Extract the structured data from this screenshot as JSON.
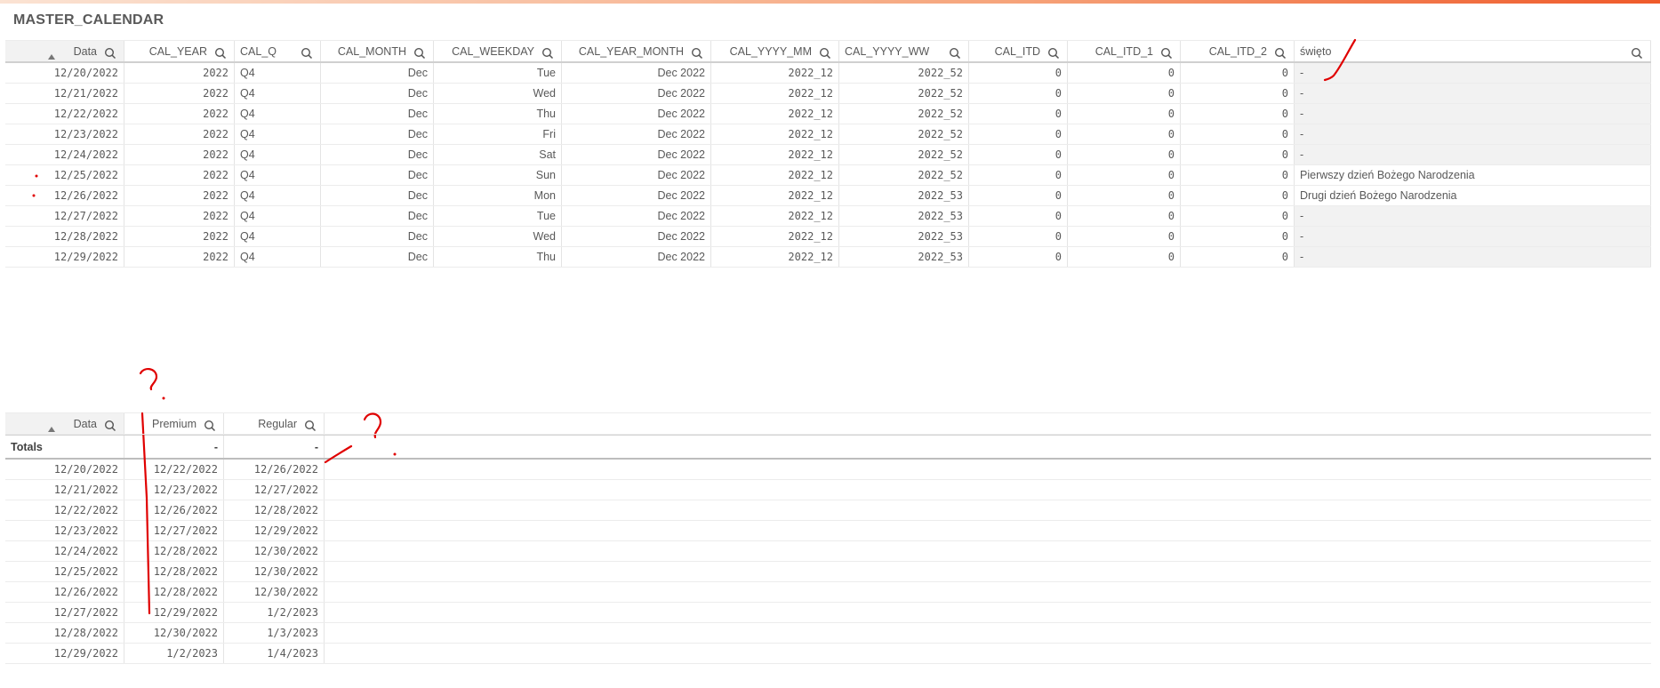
{
  "title": "MASTER_CALENDAR",
  "table1": {
    "columns": [
      "Data",
      "CAL_YEAR",
      "CAL_Q",
      "CAL_MONTH",
      "CAL_WEEKDAY",
      "CAL_YEAR_MONTH",
      "CAL_YYYY_MM",
      "CAL_YYYY_WW",
      "CAL_ITD",
      "CAL_ITD_1",
      "CAL_ITD_2",
      "święto"
    ],
    "rows": [
      [
        "12/20/2022",
        "2022",
        "Q4",
        "Dec",
        "Tue",
        "Dec 2022",
        "2022_12",
        "2022_52",
        "0",
        "0",
        "0",
        "-"
      ],
      [
        "12/21/2022",
        "2022",
        "Q4",
        "Dec",
        "Wed",
        "Dec 2022",
        "2022_12",
        "2022_52",
        "0",
        "0",
        "0",
        "-"
      ],
      [
        "12/22/2022",
        "2022",
        "Q4",
        "Dec",
        "Thu",
        "Dec 2022",
        "2022_12",
        "2022_52",
        "0",
        "0",
        "0",
        "-"
      ],
      [
        "12/23/2022",
        "2022",
        "Q4",
        "Dec",
        "Fri",
        "Dec 2022",
        "2022_12",
        "2022_52",
        "0",
        "0",
        "0",
        "-"
      ],
      [
        "12/24/2022",
        "2022",
        "Q4",
        "Dec",
        "Sat",
        "Dec 2022",
        "2022_12",
        "2022_52",
        "0",
        "0",
        "0",
        "-"
      ],
      [
        "12/25/2022",
        "2022",
        "Q4",
        "Dec",
        "Sun",
        "Dec 2022",
        "2022_12",
        "2022_52",
        "0",
        "0",
        "0",
        "Pierwszy dzień Bożego Narodzenia"
      ],
      [
        "12/26/2022",
        "2022",
        "Q4",
        "Dec",
        "Mon",
        "Dec 2022",
        "2022_12",
        "2022_53",
        "0",
        "0",
        "0",
        "Drugi dzień Bożego Narodzenia"
      ],
      [
        "12/27/2022",
        "2022",
        "Q4",
        "Dec",
        "Tue",
        "Dec 2022",
        "2022_12",
        "2022_53",
        "0",
        "0",
        "0",
        "-"
      ],
      [
        "12/28/2022",
        "2022",
        "Q4",
        "Dec",
        "Wed",
        "Dec 2022",
        "2022_12",
        "2022_53",
        "0",
        "0",
        "0",
        "-"
      ],
      [
        "12/29/2022",
        "2022",
        "Q4",
        "Dec",
        "Thu",
        "Dec 2022",
        "2022_12",
        "2022_53",
        "0",
        "0",
        "0",
        "-"
      ]
    ]
  },
  "table2": {
    "columns": [
      "Data",
      "Premium",
      "Regular"
    ],
    "totals": [
      "Totals",
      "-",
      "-"
    ],
    "rows": [
      [
        "12/20/2022",
        "12/22/2022",
        "12/26/2022"
      ],
      [
        "12/21/2022",
        "12/23/2022",
        "12/27/2022"
      ],
      [
        "12/22/2022",
        "12/26/2022",
        "12/28/2022"
      ],
      [
        "12/23/2022",
        "12/27/2022",
        "12/29/2022"
      ],
      [
        "12/24/2022",
        "12/28/2022",
        "12/30/2022"
      ],
      [
        "12/25/2022",
        "12/28/2022",
        "12/30/2022"
      ],
      [
        "12/26/2022",
        "12/28/2022",
        "12/30/2022"
      ],
      [
        "12/27/2022",
        "12/29/2022",
        "1/2/2023"
      ],
      [
        "12/28/2022",
        "12/30/2022",
        "1/3/2023"
      ],
      [
        "12/29/2022",
        "1/2/2023",
        "1/4/2023"
      ]
    ]
  },
  "colors": {
    "accent": "#ef5a2a",
    "annotation": "#e00000",
    "shade": "#f2f2f2"
  }
}
